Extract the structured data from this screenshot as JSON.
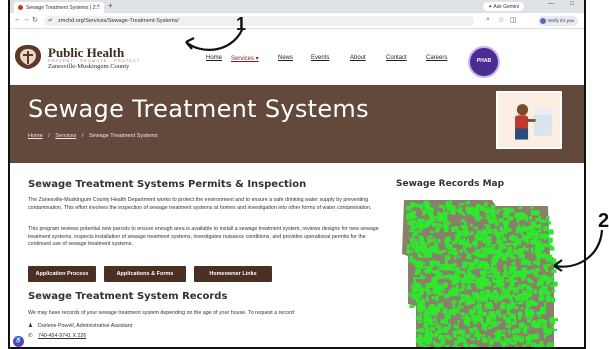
{
  "browser": {
    "tab_title": "Sewage Treatment Systems | Z...",
    "tab_close": "×",
    "new_tab": "+",
    "ask_gemini": "✦ Ask Gemini",
    "url": "zmchd.org/Services/Sewage-Treatment-Systems/",
    "verify_label": "Verify it's you",
    "controls": [
      "—",
      "□"
    ]
  },
  "header": {
    "logo_title": "Public Health",
    "logo_tagline": "PREVENT · PROMOTE · PROTECT",
    "logo_county": "Zanesville-Muskingum County",
    "nav": [
      "Home",
      "Services ▾",
      "News",
      "Events",
      "About",
      "Contact",
      "Careers"
    ],
    "badge_text": "PHAB"
  },
  "hero": {
    "title": "Sewage Treatment Systems",
    "breadcrumb": [
      "Home",
      "Services",
      "Sewage Treatment Systems"
    ],
    "breadcrumb_sep": "/"
  },
  "main": {
    "permits_heading": "Sewage Treatment Systems Permits & Inspection",
    "para1": "The Zanesville-Muskingum County Health Department works to protect the environment and to ensure a safe drinking water supply by preventing contamination. This effort involves the inspection of sewage treatment systems at homes and investigation into other forms of water contamination.",
    "para2": "This program reviews potential new parcels to ensure enough area is available to install a sewage treatment system, reviews designs for new sewage treatment systems, inspects installation of sewage treatment systems, investigates nuisance conditions, and provides operational permits for the continued use of sewage treatment systems.",
    "buttons": [
      "Application Process",
      "Applications & Forms",
      "Homeowner Links"
    ],
    "records_heading": "Sewage Treatment System Records",
    "records_intro": "We may have records of your sewage treatment system depending on the age of your house. To request a record:",
    "contact_name": "Darlene Powell, Administrative Assistant",
    "contact_phone": "740-454-9741 X 226"
  },
  "sidebar": {
    "map_heading": "Sewage Records Map"
  },
  "annotations": {
    "label1": "1",
    "label2": "2"
  },
  "colors": {
    "hero_bg": "#63493c",
    "button_bg": "#4a2f23",
    "map_green": "#2ee82e",
    "badge_purple": "#4b2c91"
  }
}
